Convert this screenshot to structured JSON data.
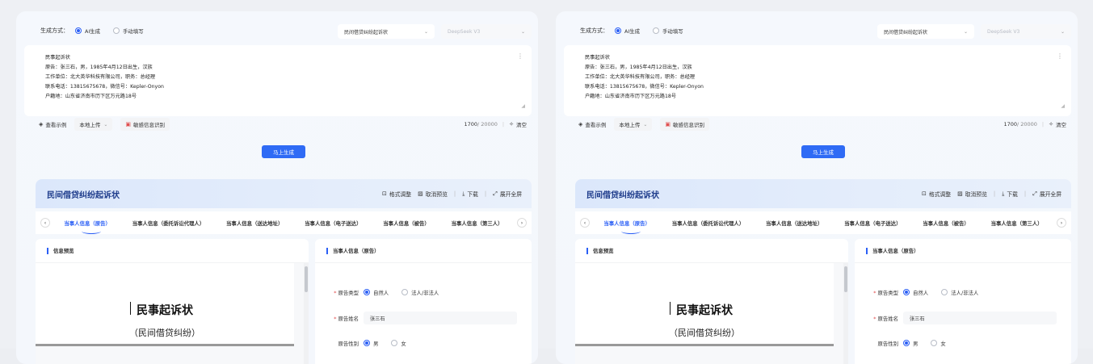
{
  "config": {
    "label": "生成方式：",
    "modes": [
      {
        "label": "AI生成",
        "selected": true
      },
      {
        "label": "手动填写",
        "selected": false
      }
    ],
    "case_type": "民间借贷纠纷起诉状",
    "model": "DeepSeek V3"
  },
  "editor": {
    "lines": [
      "民事起诉状",
      "原告：张三石，男，1985年4月12日出生，汉族",
      "工作单位：北大英华科技有限公司，职务：总经理",
      "联系电话：13815675678，微信号：Kepler-Onyon",
      "户籍地：山东省济南市历下区万元路18号"
    ]
  },
  "tools": {
    "example": "查看示例",
    "upload": "本地上传",
    "sensitive": "敏感信息识别",
    "count": "1700",
    "max": "/ 20000",
    "clear": "清空"
  },
  "generate_button": "马上生成",
  "result": {
    "title": "民间借贷纠纷起诉状",
    "actions": [
      "格式调整",
      "取消预览",
      "下载",
      "展开全屏"
    ]
  },
  "tabs": [
    "当事人信息（原告）",
    "当事人信息（委托诉讼代理人）",
    "当事人信息（送达地址）",
    "当事人信息（电子送达）",
    "当事人信息（被告）",
    "当事人信息（第三人）"
  ],
  "preview": {
    "section": "信息预览",
    "doc_title": "民事起诉状",
    "doc_subtitle": "（民间借贷纠纷）"
  },
  "form": {
    "section": "当事人信息（原告）",
    "plaintiff_type_label": "原告类型",
    "plaintiff_type_options": [
      "自然人",
      "法人/非法人"
    ],
    "name_label": "原告姓名",
    "name_value": "张三石",
    "gender_label": "原告性别",
    "gender_options": [
      "男",
      "女"
    ]
  },
  "colors": {
    "accent": "#2b5ff5",
    "title": "#1d3b8b"
  }
}
